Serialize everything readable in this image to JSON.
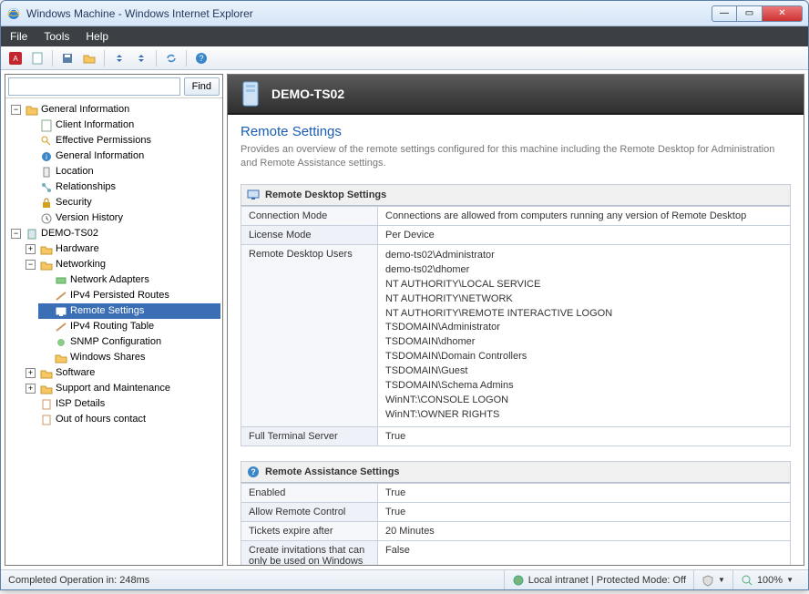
{
  "window": {
    "title": "Windows Machine - Windows Internet Explorer"
  },
  "menubar": [
    "File",
    "Tools",
    "Help"
  ],
  "find": {
    "button": "Find",
    "value": ""
  },
  "tree": {
    "general": {
      "label": "General Information",
      "children": [
        "Client Information",
        "Effective Permissions",
        "General Information",
        "Location",
        "Relationships",
        "Security",
        "Version History"
      ]
    },
    "host": {
      "label": "DEMO-TS02",
      "children": {
        "hardware": "Hardware",
        "networking": {
          "label": "Networking",
          "children": [
            "Network Adapters",
            "IPv4 Persisted Routes",
            "Remote Settings",
            "IPv4 Routing Table",
            "SNMP Configuration",
            "Windows Shares"
          ]
        },
        "software": "Software",
        "support": "Support and Maintenance",
        "isp": "ISP Details",
        "ooh": "Out of hours contact"
      }
    }
  },
  "panel": {
    "host": "DEMO-TS02",
    "section_title": "Remote Settings",
    "section_desc": "Provides an overview of the remote settings configured for this machine including the Remote Desktop for Administration and Remote Assistance settings.",
    "rds": {
      "title": "Remote Desktop Settings",
      "rows": {
        "connection_mode": {
          "k": "Connection Mode",
          "v": "Connections are allowed from computers running any version of Remote Desktop"
        },
        "license_mode": {
          "k": "License Mode",
          "v": "Per Device"
        },
        "users": {
          "k": "Remote Desktop Users",
          "list": [
            "demo-ts02\\Administrator",
            "demo-ts02\\dhomer",
            "NT AUTHORITY\\LOCAL SERVICE",
            "NT AUTHORITY\\NETWORK",
            "NT AUTHORITY\\REMOTE INTERACTIVE LOGON",
            "TSDOMAIN\\Administrator",
            "TSDOMAIN\\dhomer",
            "TSDOMAIN\\Domain Controllers",
            "TSDOMAIN\\Guest",
            "TSDOMAIN\\Schema Admins",
            "WinNT:\\CONSOLE LOGON",
            "WinNT:\\OWNER RIGHTS"
          ]
        },
        "full_ts": {
          "k": "Full Terminal Server",
          "v": "True"
        }
      }
    },
    "ras": {
      "title": "Remote Assistance Settings",
      "rows": {
        "enabled": {
          "k": "Enabled",
          "v": "True"
        },
        "allow_rc": {
          "k": "Allow Remote Control",
          "v": "True"
        },
        "tickets": {
          "k": "Tickets expire after",
          "v": "20 Minutes"
        },
        "vista": {
          "k": "Create invitations that can only be used on Windows Vista or later",
          "v": "False"
        }
      }
    }
  },
  "status": {
    "left": "Completed Operation in: 248ms",
    "zone": "Local intranet | Protected Mode: Off",
    "zoom": "100%"
  }
}
